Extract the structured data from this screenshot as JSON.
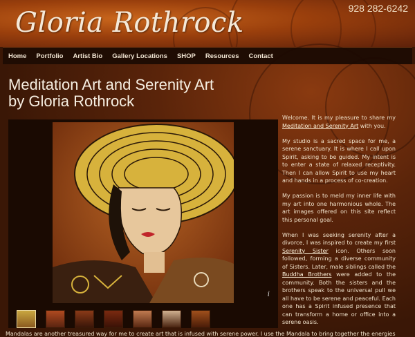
{
  "header": {
    "logo_text": "Gloria Rothrock",
    "phone": "928 282-6242"
  },
  "nav": {
    "items": [
      "Home",
      "Portfolio",
      "Artist Bio",
      "Gallery Locations",
      "SHOP",
      "Resources",
      "Contact"
    ]
  },
  "main": {
    "title_line1": "Meditation Art and Serenity Art",
    "title_line2": "by Gloria Rothrock",
    "gallery": {
      "info_label": "i",
      "thumbnail_count": 7
    },
    "intro": {
      "p1_pre": "Welcome. It is my pleasure to share my ",
      "p1_link": "Meditation and Serenity Art",
      "p1_post": " with you.",
      "p2": "My studio is a sacred space for me, a serene sanctuary. It is where I call upon Spirit, asking to be guided. My intent is to enter a state of relaxed receptivity. Then I can allow Spirit to use my heart and hands in a process of co-creation.",
      "p3": "My passion is to meld my inner life with my art into one harmonious whole. The art images offered on this site reflect this personal goal.",
      "p4_pre": "When I was seeking serenity after a divorce, I was inspired to create my first ",
      "p4_link1": "Serenity Sister",
      "p4_mid": " icon. Others soon followed, forming a diverse community of Sisters. Later, male siblings called the ",
      "p4_link2": "Buddha Brothers",
      "p4_post": " were added to the community. Both the sisters and the brothers speak to the universal pull we all have to be serene and peaceful. Each one has a Spirit infused presence that can transform a home or office into a serene oasis."
    },
    "bottom_text": "Mandalas are another treasured way for me to create art that is infused with serene power. I use the Mandala to bring together the energies"
  }
}
